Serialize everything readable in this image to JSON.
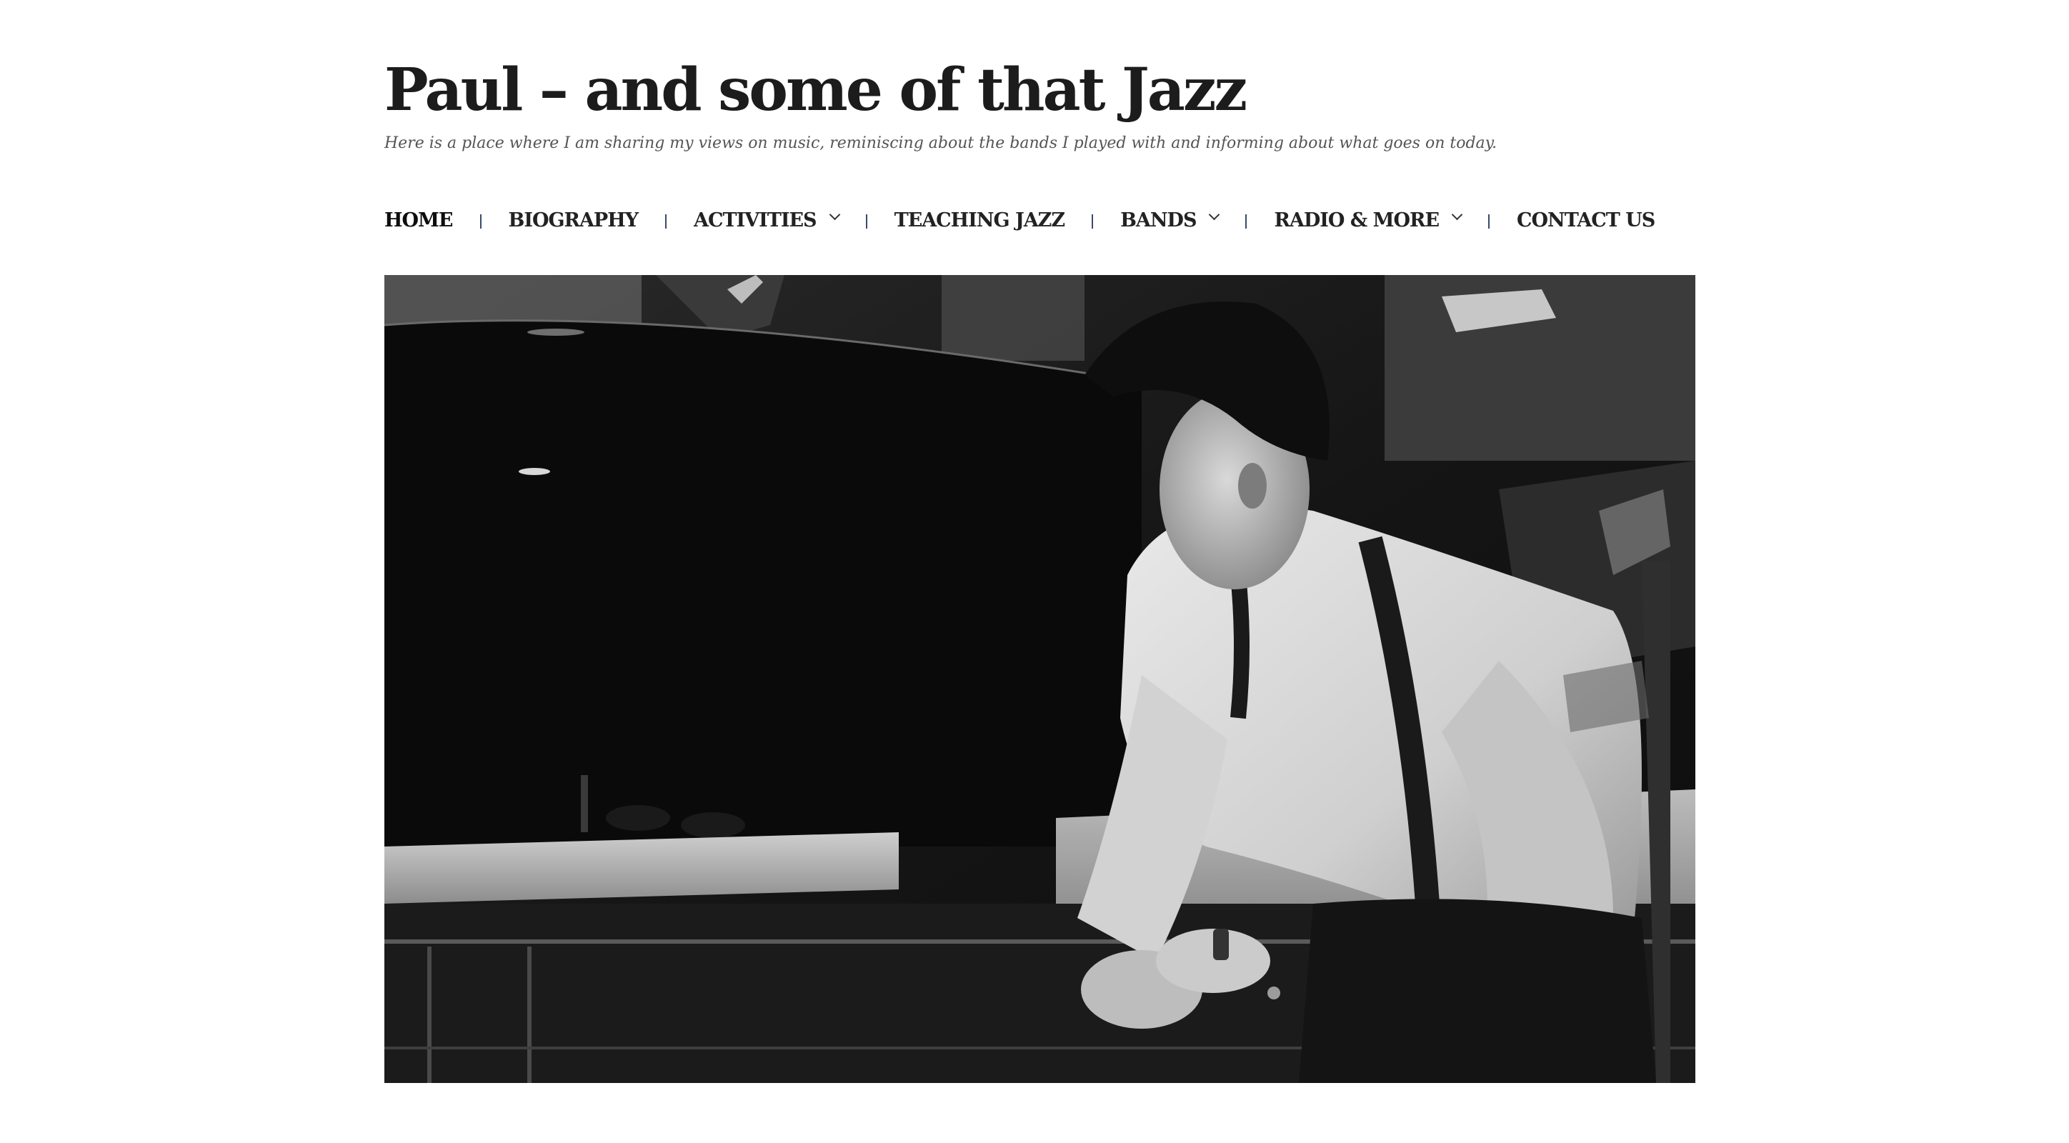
{
  "site": {
    "title": "Paul – and some of that Jazz",
    "tagline": "Here is a place where I am sharing my views on music, reminiscing about the bands I played with and informing about what goes on today."
  },
  "nav": {
    "separator": "|",
    "items": [
      {
        "label": "HOME",
        "active": true,
        "has_dropdown": false
      },
      {
        "label": "BIOGRAPHY",
        "active": false,
        "has_dropdown": false
      },
      {
        "label": "ACTIVITIES",
        "active": false,
        "has_dropdown": true
      },
      {
        "label": "TEACHING JAZZ",
        "active": false,
        "has_dropdown": false
      },
      {
        "label": "BANDS",
        "active": false,
        "has_dropdown": true
      },
      {
        "label": "RADIO & MORE",
        "active": false,
        "has_dropdown": true
      },
      {
        "label": "CONTACT US",
        "active": false,
        "has_dropdown": false
      }
    ]
  },
  "colors": {
    "text": "#1c1c1c",
    "tagline": "#555555",
    "separator": "#3a4a6a",
    "background": "#ffffff"
  },
  "hero": {
    "style": "black-and-white photograph",
    "icon": "jazz-pianist-photo"
  }
}
